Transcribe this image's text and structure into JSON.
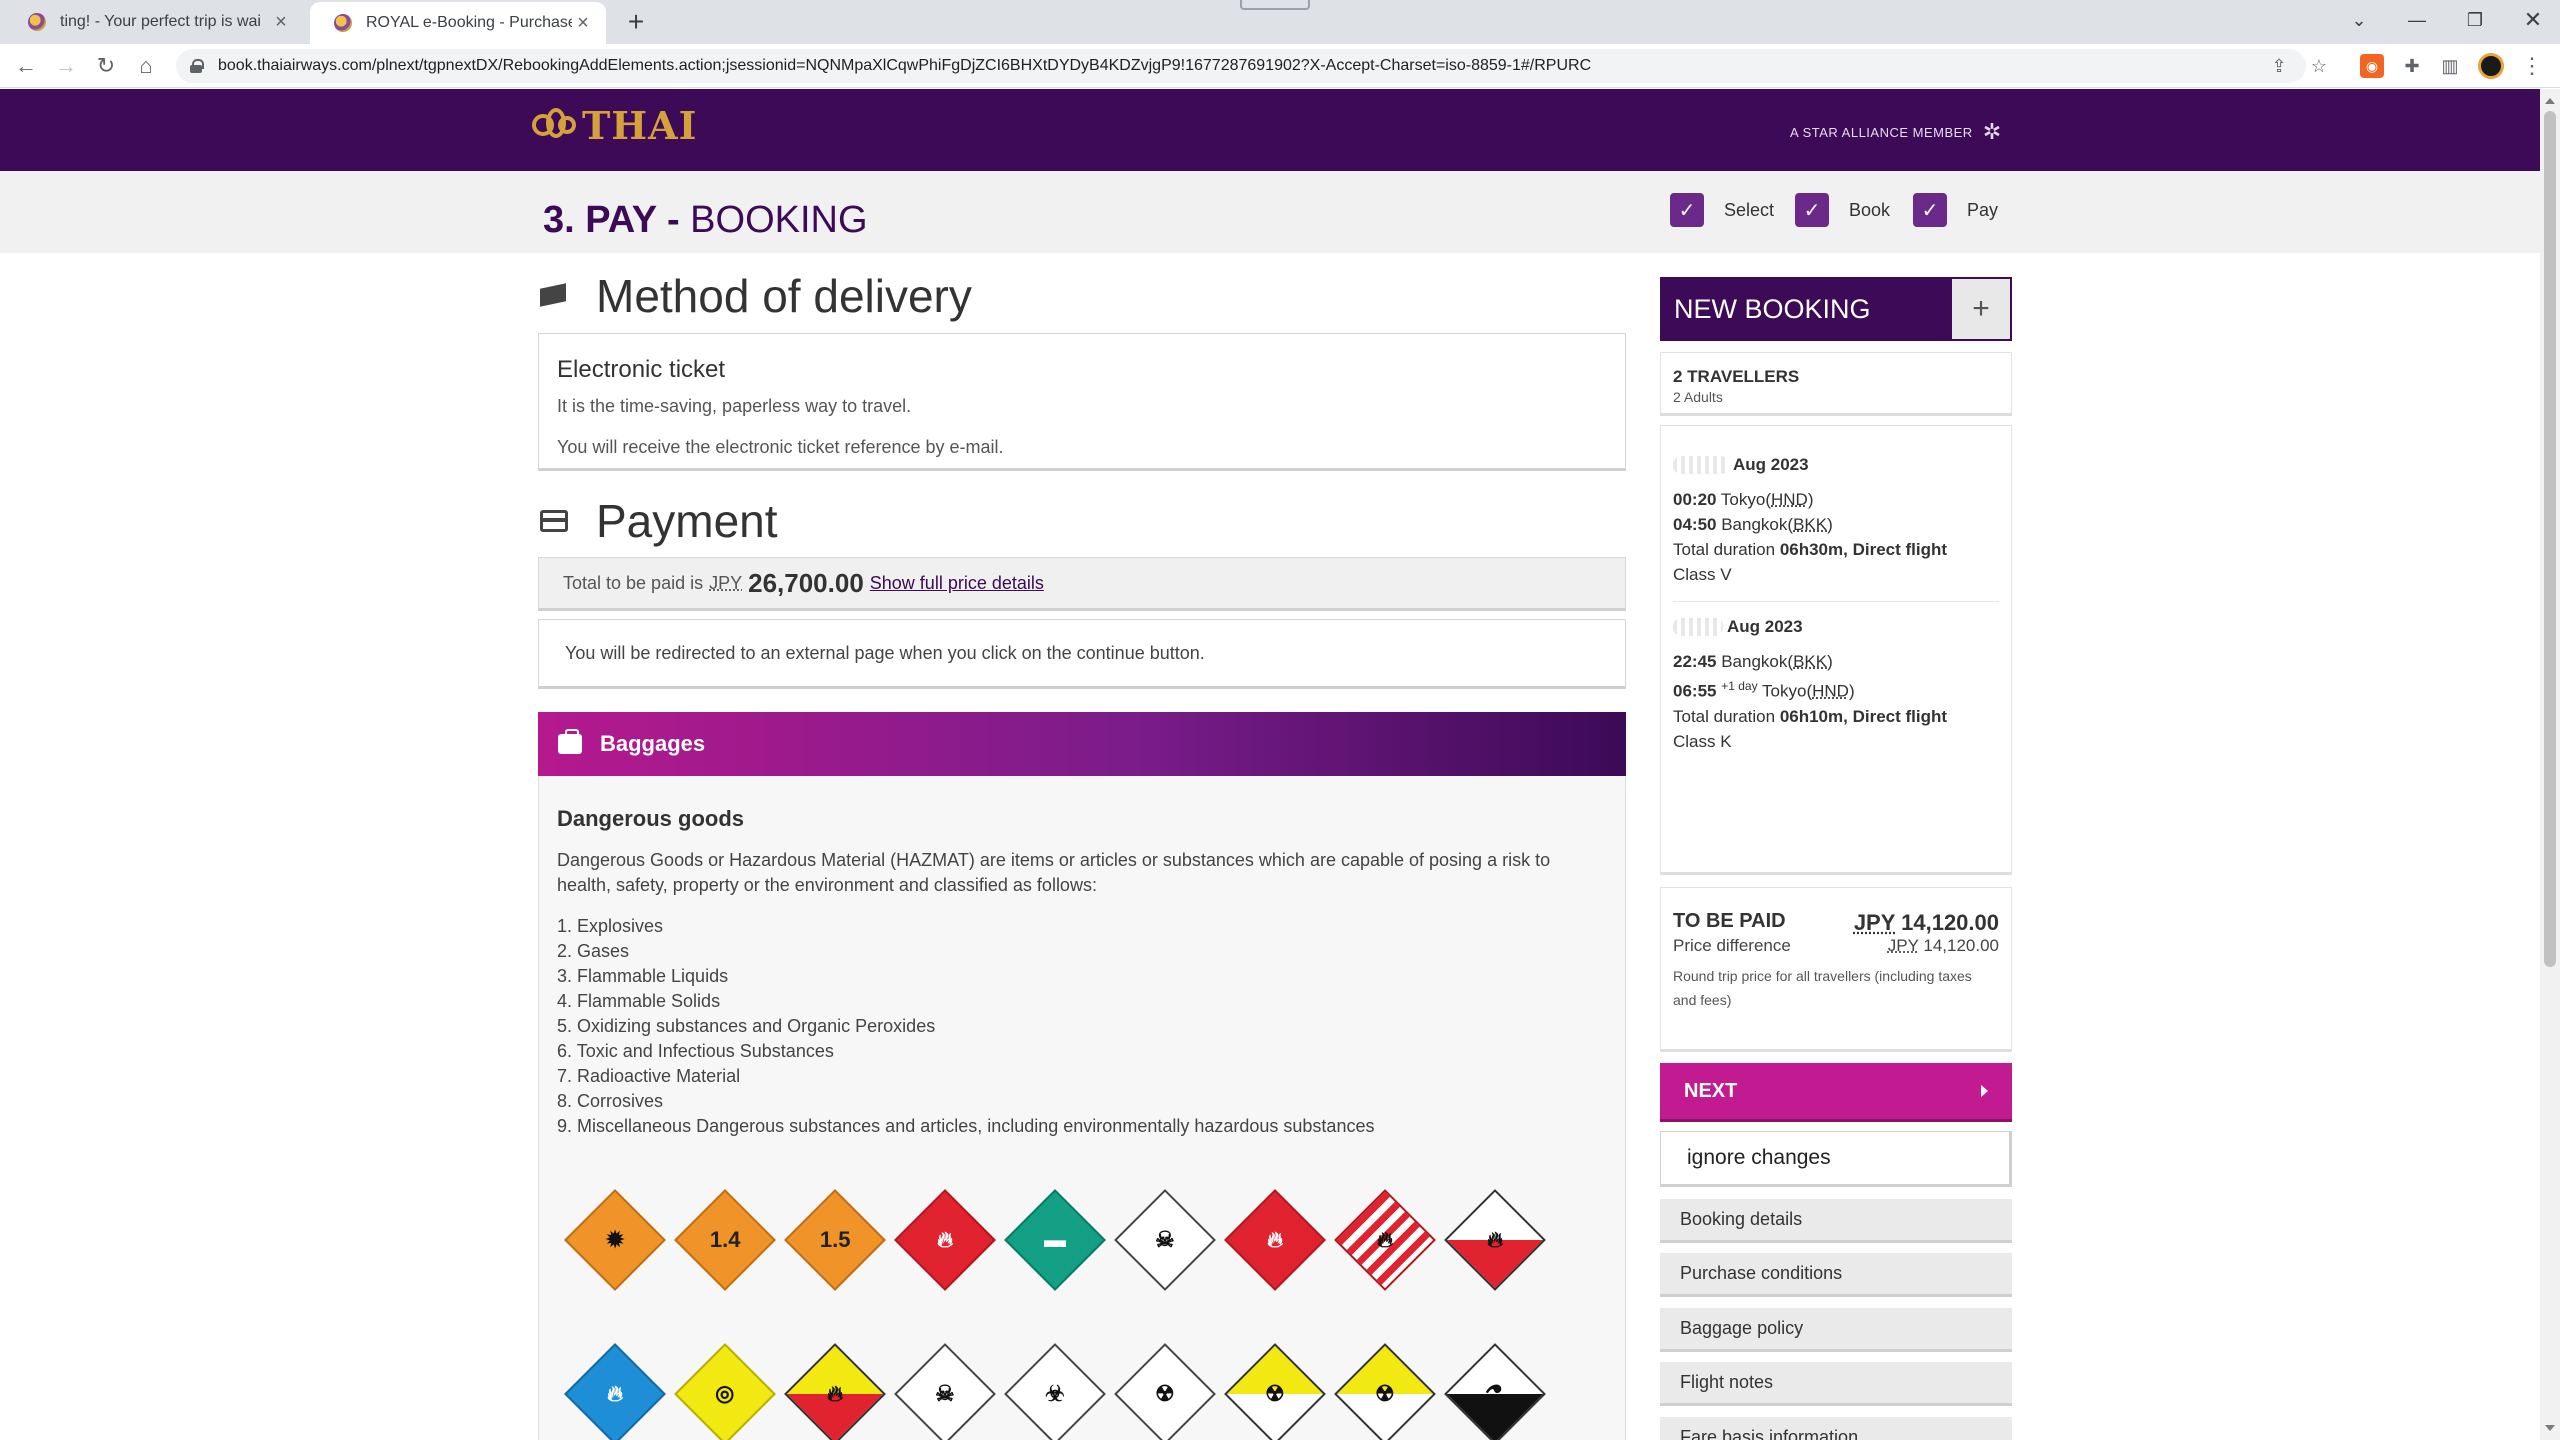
{
  "browser": {
    "tabs": [
      {
        "title": "ting! - Your perfect trip is wai",
        "active": false
      },
      {
        "title": "ROYAL e-Booking - Purchase",
        "active": true
      }
    ],
    "url": "book.thaiairways.com/plnext/tgpnextDX/RebookingAddElements.action;jsessionid=NQNMpaXlCqwPhiFgDjZCI6BHXtDYDyB4KDZvjgP9!1677287691902?X-Accept-Charset=iso-8859-1#/RPURC"
  },
  "header": {
    "logo": "THAI",
    "alliance": "A STAR ALLIANCE MEMBER"
  },
  "steps": {
    "heading_bold": "3. PAY -",
    "heading_light": "BOOKING",
    "items": [
      "Select",
      "Book",
      "Pay"
    ]
  },
  "delivery": {
    "title": "Method of delivery",
    "heading": "Electronic ticket",
    "line1": "It is the time-saving, paperless way to travel.",
    "line2": "You will receive the electronic ticket reference by e-mail."
  },
  "payment": {
    "title": "Payment",
    "total_label": "Total to be paid is",
    "currency": "JPY",
    "amount": "26,700.00",
    "details_link": "Show full price details",
    "redirect_note": "You will be redirected to an external page when you click on the continue button."
  },
  "baggage": {
    "title": "Baggages",
    "dg_title": "Dangerous goods",
    "dg_desc": "Dangerous Goods or Hazardous Material (HAZMAT) are items or articles or substances which are capable of posing a risk to health, safety, property or the environment and classified as follows:",
    "classes": [
      "1. Explosives",
      "2. Gases",
      "3. Flammable Liquids",
      "4. Flammable Solids",
      "5. Oxidizing substances and Organic Peroxides",
      "6. Toxic and Infectious Substances",
      "7. Radioactive Material",
      "8. Corrosives",
      "9. Miscellaneous Dangerous substances and articles, including environmentally hazardous substances"
    ],
    "label_14": "1.4",
    "label_15": "1.5"
  },
  "sidebar": {
    "new_booking": "NEW BOOKING",
    "travellers": "2 TRAVELLERS",
    "adults": "2 Adults",
    "outbound": {
      "month": "Aug 2023",
      "dep_time": "00:20",
      "dep_city": "Tokyo",
      "dep_code": "HND",
      "arr_time": "04:50",
      "arr_city": "Bangkok",
      "arr_code": "BKK",
      "duration_label": "Total duration",
      "duration": "06h30m, Direct flight",
      "class": "Class V"
    },
    "inbound": {
      "month": "Aug 2023",
      "dep_time": "22:45",
      "dep_city": "Bangkok",
      "dep_code": "BKK",
      "arr_time": "06:55",
      "plus_day": "+1 day",
      "arr_city": "Tokyo",
      "arr_code": "HND",
      "duration_label": "Total duration",
      "duration": "06h10m, Direct flight",
      "class": "Class K"
    },
    "to_be_paid_label": "TO BE PAID",
    "to_be_paid_currency": "JPY",
    "to_be_paid_amount": "14,120.00",
    "price_diff_label": "Price difference",
    "price_diff_currency": "JPY",
    "price_diff_amount": "14,120.00",
    "price_note": "Round trip price for all travellers (including taxes and fees)",
    "next": "NEXT",
    "ignore": "ignore changes",
    "links": [
      "Booking details",
      "Purchase conditions",
      "Baggage policy",
      "Flight notes",
      "Fare basis information"
    ]
  }
}
